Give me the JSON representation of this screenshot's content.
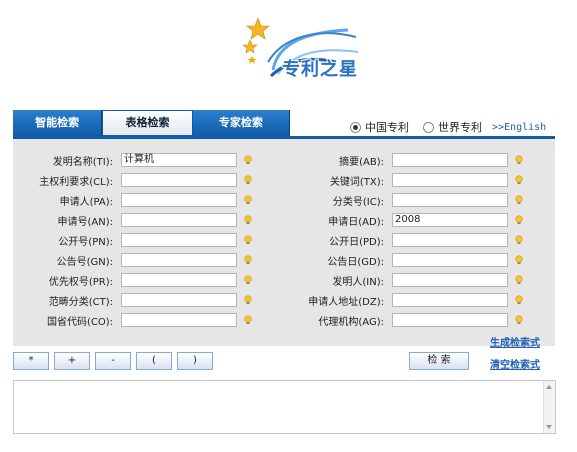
{
  "logo": {
    "text": "专利之星"
  },
  "tabs": [
    {
      "label": "智能检索"
    },
    {
      "label": "表格检索"
    },
    {
      "label": "专家检索"
    }
  ],
  "scope": {
    "china": "中国专利",
    "world": "世界专利",
    "english": ">>English"
  },
  "left_fields": [
    {
      "label": "发明名称(TI):",
      "value": "计算机"
    },
    {
      "label": "主权利要求(CL):",
      "value": ""
    },
    {
      "label": "申请人(PA):",
      "value": ""
    },
    {
      "label": "申请号(AN):",
      "value": ""
    },
    {
      "label": "公开号(PN):",
      "value": ""
    },
    {
      "label": "公告号(GN):",
      "value": ""
    },
    {
      "label": "优先权号(PR):",
      "value": ""
    },
    {
      "label": "范畴分类(CT):",
      "value": ""
    },
    {
      "label": "国省代码(CO):",
      "value": ""
    }
  ],
  "right_fields": [
    {
      "label": "摘要(AB):",
      "value": ""
    },
    {
      "label": "关键词(TX):",
      "value": ""
    },
    {
      "label": "分类号(IC):",
      "value": ""
    },
    {
      "label": "申请日(AD):",
      "value": "2008"
    },
    {
      "label": "公开日(PD):",
      "value": ""
    },
    {
      "label": "公告日(GD):",
      "value": ""
    },
    {
      "label": "发明人(IN):",
      "value": ""
    },
    {
      "label": "申请人地址(DZ):",
      "value": ""
    },
    {
      "label": "代理机构(AG):",
      "value": ""
    }
  ],
  "actions": {
    "generate": "生成检索式",
    "clear": "清空检索式",
    "search": "检 索"
  },
  "ops": [
    "*",
    "+",
    "-",
    "(",
    ")"
  ]
}
